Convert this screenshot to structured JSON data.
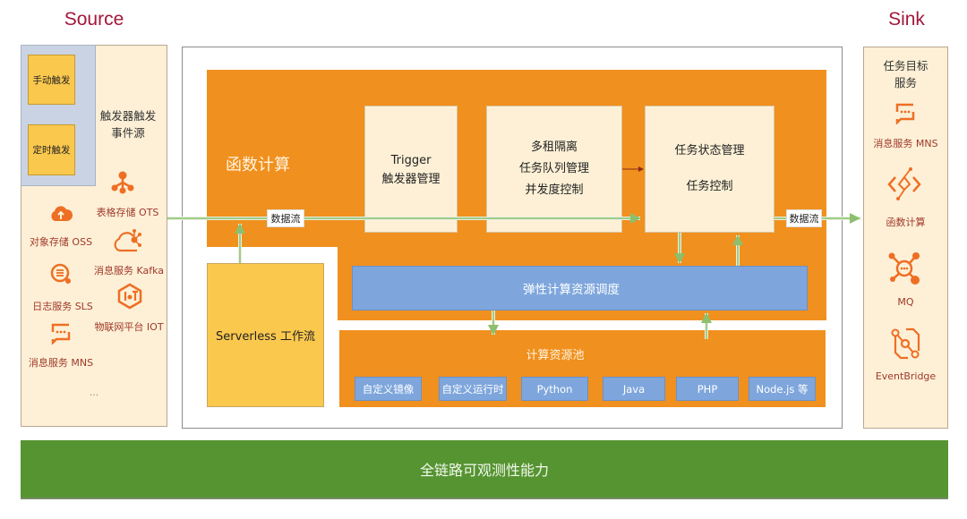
{
  "source": {
    "title": "Source",
    "manual_trigger": "手动触发",
    "timer_trigger": "定时触发",
    "event_source_label": "触发器触发\n事件源",
    "services": [
      {
        "name": "表格存储 OTS",
        "icon": "table-store-icon"
      },
      {
        "name": "对象存储 OSS",
        "icon": "object-storage-icon"
      },
      {
        "name": "消息服务 Kafka",
        "icon": "kafka-cloud-icon"
      },
      {
        "name": "日志服务 SLS",
        "icon": "log-service-icon"
      },
      {
        "name": "物联网平台 IOT",
        "icon": "iot-icon"
      },
      {
        "name": "消息服务 MNS",
        "icon": "message-service-icon"
      }
    ],
    "more": "..."
  },
  "sink": {
    "title": "Sink",
    "heading": "任务目标\n服务",
    "services": [
      {
        "name": "消息服务 MNS",
        "icon": "message-service-icon"
      },
      {
        "name": "函数计算",
        "icon": "function-compute-icon"
      },
      {
        "name": "MQ",
        "icon": "mq-icon"
      },
      {
        "name": "EventBridge",
        "icon": "eventbridge-icon"
      }
    ]
  },
  "core": {
    "fc_title": "函数计算",
    "trigger_box": [
      "Trigger",
      "触发器管理"
    ],
    "queue_box": [
      "多租隔离",
      "任务队列管理",
      "并发度控制"
    ],
    "state_box": [
      "任务状态管理",
      "",
      "任务控制"
    ],
    "elastic_scheduling": "弹性计算资源调度",
    "serverless_workflow": "Serverless 工作流",
    "resource_pool": {
      "title": "计算资源池",
      "runtimes": [
        "自定义镜像",
        "自定义运行时",
        "Python",
        "Java",
        "PHP",
        "Node.js 等"
      ]
    },
    "data_flow_label": "数据流",
    "data_flow_out_label": "数据流"
  },
  "observability": "全链路可观测性能力",
  "colors": {
    "orange": "#f0901e",
    "cream": "#fdf0d6",
    "blue": "#7ea6dc",
    "yellow": "#fbc84e",
    "green": "#569432",
    "title_red": "#a3173a",
    "arrow_green": "#8cbf6e"
  }
}
